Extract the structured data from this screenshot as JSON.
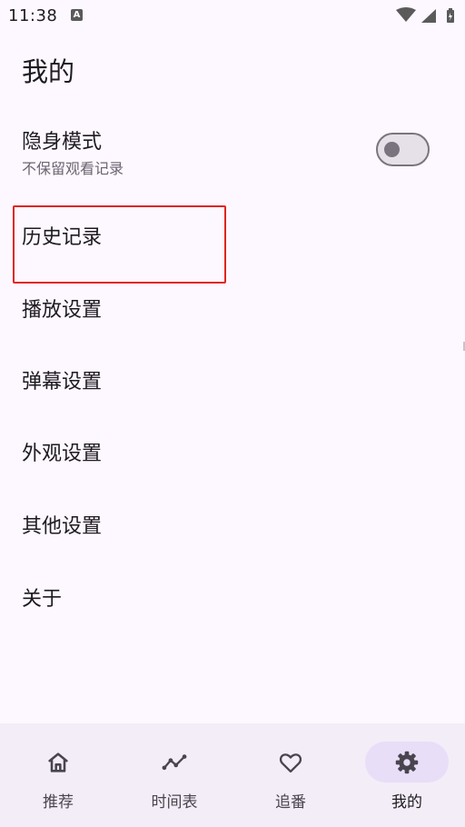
{
  "status_bar": {
    "time": "11:38",
    "notification_glyph": "A",
    "icons": [
      "wifi-icon",
      "signal-icon",
      "battery-icon"
    ]
  },
  "page": {
    "title": "我的"
  },
  "settings": {
    "incognito": {
      "label": "隐身模式",
      "sublabel": "不保留观看记录",
      "enabled": false
    },
    "history": {
      "label": "历史记录"
    },
    "playback": {
      "label": "播放设置"
    },
    "danmaku": {
      "label": "弹幕设置"
    },
    "appearance": {
      "label": "外观设置"
    },
    "other": {
      "label": "其他设置"
    },
    "about": {
      "label": "关于"
    }
  },
  "bottom_nav": {
    "items": [
      {
        "label": "推荐",
        "icon": "home-icon",
        "active": false
      },
      {
        "label": "时间表",
        "icon": "timeline-icon",
        "active": false
      },
      {
        "label": "追番",
        "icon": "heart-icon",
        "active": false
      },
      {
        "label": "我的",
        "icon": "settings-icon",
        "active": true
      }
    ]
  },
  "colors": {
    "background": "#fdf7ff",
    "nav_background": "#f3edf7",
    "active_pill": "#e8def8",
    "highlight": "#e0261c",
    "text_primary": "#1d1b20",
    "text_secondary": "#6a6570"
  }
}
